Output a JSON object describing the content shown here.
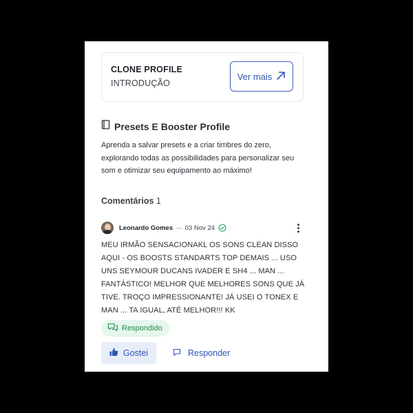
{
  "course": {
    "title": "CLONE PROFILE",
    "section": "INTRODUÇÃO",
    "more_button": "Ver mais",
    "more_icon": "arrow-up-right-icon"
  },
  "lesson": {
    "icon": "book-icon",
    "title": "Presets E Booster Profile",
    "description": "Aprenda a salvar presets e a criar timbres do zero, explorando todas as possibilidades para personalizar seu som e otimizar seu equipamento ao máximo!"
  },
  "comments": {
    "label": "Comentários",
    "count": "1",
    "items": [
      {
        "author": "Leonardo Gomes",
        "separator": "—",
        "date": "03 Nov 24",
        "verified_icon": "check-circle-icon",
        "text": "MEU IRMÃO SENSACIONAKL OS SONS CLEAN DISSO AQUI - OS BOOSTS STANDARTS TOP DEMAIS ... USO UNS SEYMOUR DUCANS IVADER E SH4 ... MAN ... FANTÁSTICO! MELHOR QUE MELHORES SONS QUE JÁ TIVE. TROÇO IMPRESSIONANTE! JÁ USEI O TONEX E MAN ... TA IGUAL, ATÉ MELHOR!!! KK",
        "status": "Respondido",
        "like_label": "Gostei",
        "reply_label": "Responder"
      }
    ]
  },
  "colors": {
    "accent": "#2f54b5",
    "answered_bg": "#e6f6ec",
    "answered_fg": "#1f8a4a",
    "like_bg": "#e8eef9"
  }
}
